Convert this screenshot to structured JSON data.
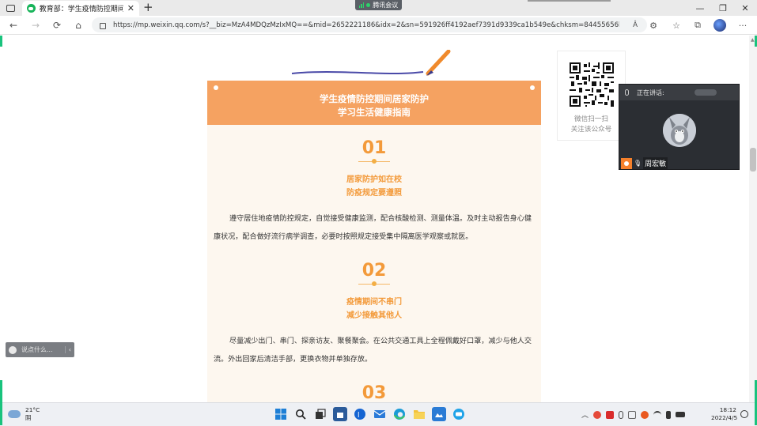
{
  "browser": {
    "tab_title": "教育部：学生疫情防控期间学习",
    "meeting_pill": "腾讯会议",
    "url": "https://mp.weixin.qq.com/s?__biz=MzA4MDQzMzIxMQ==&mid=2652221186&idx=2&sn=591926ff4192aef7391d9339ca1b549e&chksm=84455656b332df404ed906...",
    "reader_label": "Â",
    "window_minimize": "—",
    "window_restore": "❐",
    "window_close": "✕",
    "ellipsis": "···"
  },
  "article": {
    "banner_line1": "学生疫情防控期间居家防护",
    "banner_line2": "学习生活健康指南",
    "sections": [
      {
        "num": "01",
        "sub1": "居家防护如在校",
        "sub2": "防疫规定要遵照",
        "text": "遵守居住地疫情防控规定，自觉接受健康监测，配合核酸检测、测量体温。及时主动报告身心健康状况，配合做好流行病学调查，必要时按照规定接受集中隔离医学观察或就医。"
      },
      {
        "num": "02",
        "sub1": "疫情期间不串门",
        "sub2": "减少接触其他人",
        "text": "尽量减少出门、串门、探亲访友、聚餐聚会。在公共交通工具上全程佩戴好口罩，减少与他人交流。外出回家后清洁手部，更换衣物并单独存放。"
      },
      {
        "num": "03"
      }
    ]
  },
  "qr": {
    "line1": "微信扫一扫",
    "line2": "关注该公众号"
  },
  "meeting": {
    "speaking_label": "正在讲话:",
    "participant_name": "周宏敏"
  },
  "comment_box": {
    "placeholder": "说点什么...",
    "chevron": "‹"
  },
  "taskbar": {
    "temperature": "21°C",
    "weather": "阴",
    "time": "18:12",
    "date": "2022/4/5"
  },
  "colors": {
    "banner": "#f5a261",
    "accent": "#f39a3a",
    "article_bg": "#fdf7ef",
    "meeting_bg": "#2b2e33",
    "frame_green": "#19c37d"
  }
}
